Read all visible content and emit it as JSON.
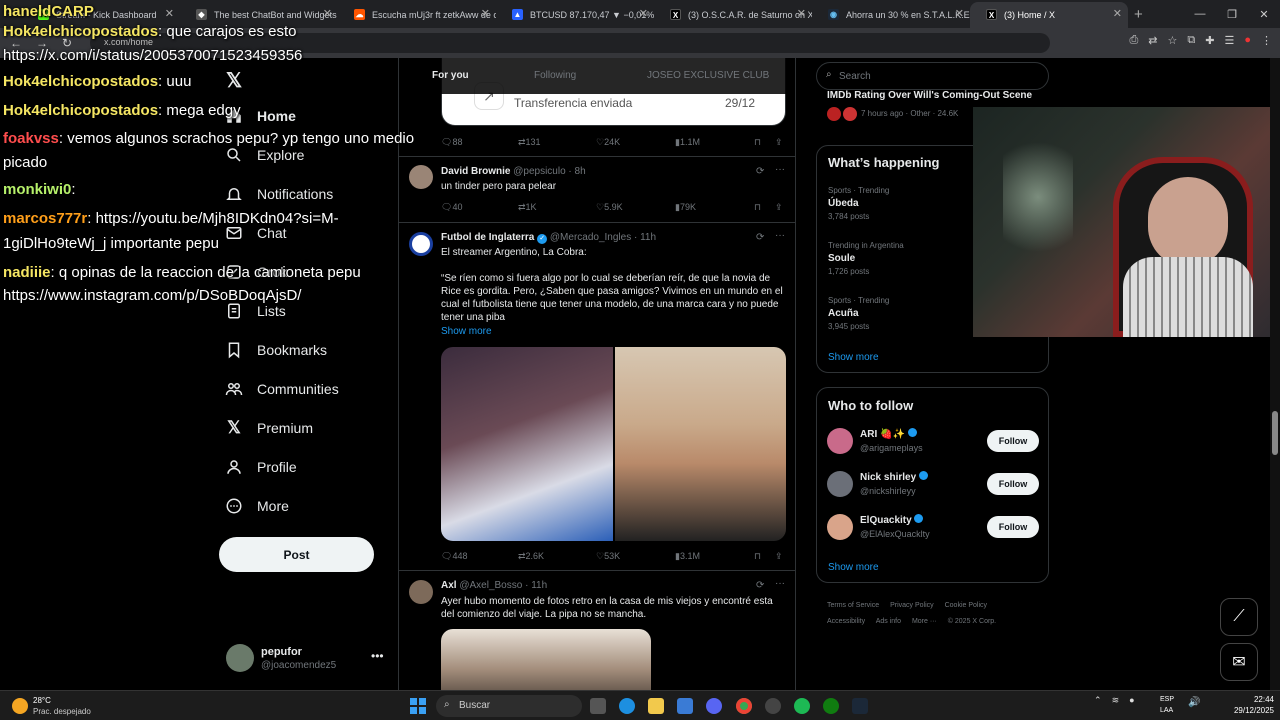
{
  "browser": {
    "tabs": [
      {
        "title": "Stream - Kick Dashboard",
        "fav": "K",
        "color": "#53fc18"
      },
      {
        "title": "The best ChatBot and Widgets",
        "fav": "◆",
        "color": "#555"
      },
      {
        "title": "Escucha mUj3r ft zetkAww de c",
        "fav": "☁",
        "color": "#ff5500"
      },
      {
        "title": "BTCUSD 87.170,47 ▼ −0,01% S",
        "fav": "▲",
        "color": "#2962ff"
      },
      {
        "title": "(3) O.S.C.A.R. de Saturno on X",
        "fav": "𝕏",
        "color": "#000"
      },
      {
        "title": "Ahorra un 30 % en S.T.A.L.K.E.R.",
        "fav": "◉",
        "color": "#1b2838"
      },
      {
        "title": "(3) Home / X",
        "fav": "𝕏",
        "color": "#000"
      }
    ],
    "url": "x.com/home"
  },
  "chat": [
    {
      "user": "haneldCARP",
      "msg": "",
      "color": "#f5e663"
    },
    {
      "user": "Hok4elchicopostados",
      "msg": ": que carajos es esto",
      "color": "#f5e663"
    },
    {
      "user": "",
      "msg": "https://x.com/i/status/2005370071523459356",
      "color": "#f5e663"
    },
    {
      "user": "Hok4elchicopostados",
      "msg": ": uuu",
      "color": "#f5e663"
    },
    {
      "user": "Hok4elchicopostados",
      "msg": ": mega edgy",
      "color": "#f5e663"
    },
    {
      "user": "foakvss",
      "msg": ": vemos algunos scrachos pepu? yp tengo uno medio",
      "color": "#ff4d4d"
    },
    {
      "user": "",
      "msg": "picado",
      "color": "#ff4d4d"
    },
    {
      "user": "monkiwi0",
      "msg": ":",
      "color": "#b6f06a"
    },
    {
      "user": "marcos777r",
      "msg": ": https://youtu.be/Mjh8IDKdn04?si=M-",
      "color": "#ff9f1a"
    },
    {
      "user": "",
      "msg": "1giDlHo9teWj_j importante pepu",
      "color": "#ff9f1a"
    },
    {
      "user": "nadiiie",
      "msg": ": q opinas de la reaccion de la camioneta pepu",
      "color": "#f5e663"
    },
    {
      "user": "",
      "msg": "https://www.instagram.com/p/DSoBDoqAjsD/",
      "color": "#f5e663"
    }
  ],
  "nav": {
    "items": [
      "Home",
      "Explore",
      "Notifications",
      "Chat",
      "Grok",
      "Lists",
      "Bookmarks",
      "Communities",
      "Premium",
      "Profile",
      "More"
    ],
    "post_label": "Post",
    "account_name": "pepufor",
    "account_handle": "@joacomendez5"
  },
  "feed": {
    "tabs": [
      "For you",
      "Following",
      "JOSEO EXCLUSIVE CLUB"
    ],
    "transfer_card": {
      "text": "Transferencia enviada",
      "date": "29/12"
    },
    "post0_actions": [
      "88",
      "131",
      "24K",
      "1.1M"
    ],
    "posts": [
      {
        "name": "David Brownie",
        "handle": "@pepsiculo · 8h",
        "text": "un tinder pero para pelear",
        "actions": [
          "40",
          "1K",
          "5.9K",
          "79K"
        ]
      },
      {
        "name": "Futbol de Inglaterra",
        "handle": "@Mercado_Ingles · 11h",
        "text": "El streamer Argentino, La Cobra:",
        "text2": "“Se ríen como si fuera algo por lo cual se deberían reír, de que la novia de Rice es gordita. Pero, ¿Saben que pasa amigos? Vivimos en un mundo en el cual el futbolista tiene que tener una modelo, de una marca cara y no puede tener una piba",
        "more": "Show more",
        "actions": [
          "448",
          "2.6K",
          "53K",
          "3.1M"
        ]
      },
      {
        "name": "Axl",
        "handle": "@Axel_Bosso · 11h",
        "text": "Ayer hubo momento de fotos retro en la casa de mis viejos y encontré esta del comienzo del viaje. La pipa no se mancha.",
        "actions": []
      }
    ]
  },
  "rail": {
    "search_placeholder": "Search",
    "top_trend": "IMDb Rating Over Will's Coming-Out Scene",
    "top_trend_meta": "7 hours ago · Other · 24.6K",
    "happening_title": "What’s happening",
    "trends": [
      {
        "cat": "Sports · Trending",
        "topic": "Úbeda",
        "count": "3,784 posts"
      },
      {
        "cat": "Trending in Argentina",
        "topic": "Soule",
        "count": "1,726 posts"
      },
      {
        "cat": "Sports · Trending",
        "topic": "Acuña",
        "count": "3,945 posts"
      }
    ],
    "show_more": "Show more",
    "wtf_title": "Who to follow",
    "follow": [
      {
        "name": "ARI 🍓✨",
        "handle": "@arigameplays",
        "color": "#c96a8a"
      },
      {
        "name": "Nick shirley",
        "handle": "@nickshirleyy",
        "color": "#6b6f78"
      },
      {
        "name": "ElQuackity",
        "handle": "@ElAlexQuacklty",
        "color": "#d9a48a"
      }
    ],
    "follow_label": "Follow",
    "footer": [
      "Terms of Service",
      "Privacy Policy",
      "Cookie Policy",
      "Accessibility",
      "Ads info",
      "More ···",
      "© 2025 X Corp."
    ]
  },
  "taskbar": {
    "temp": "28°C",
    "weather": "Prac. despejado",
    "search": "Buscar",
    "lang1": "ESP",
    "lang2": "LAA",
    "time": "22:44",
    "date": "29/12/2025"
  }
}
